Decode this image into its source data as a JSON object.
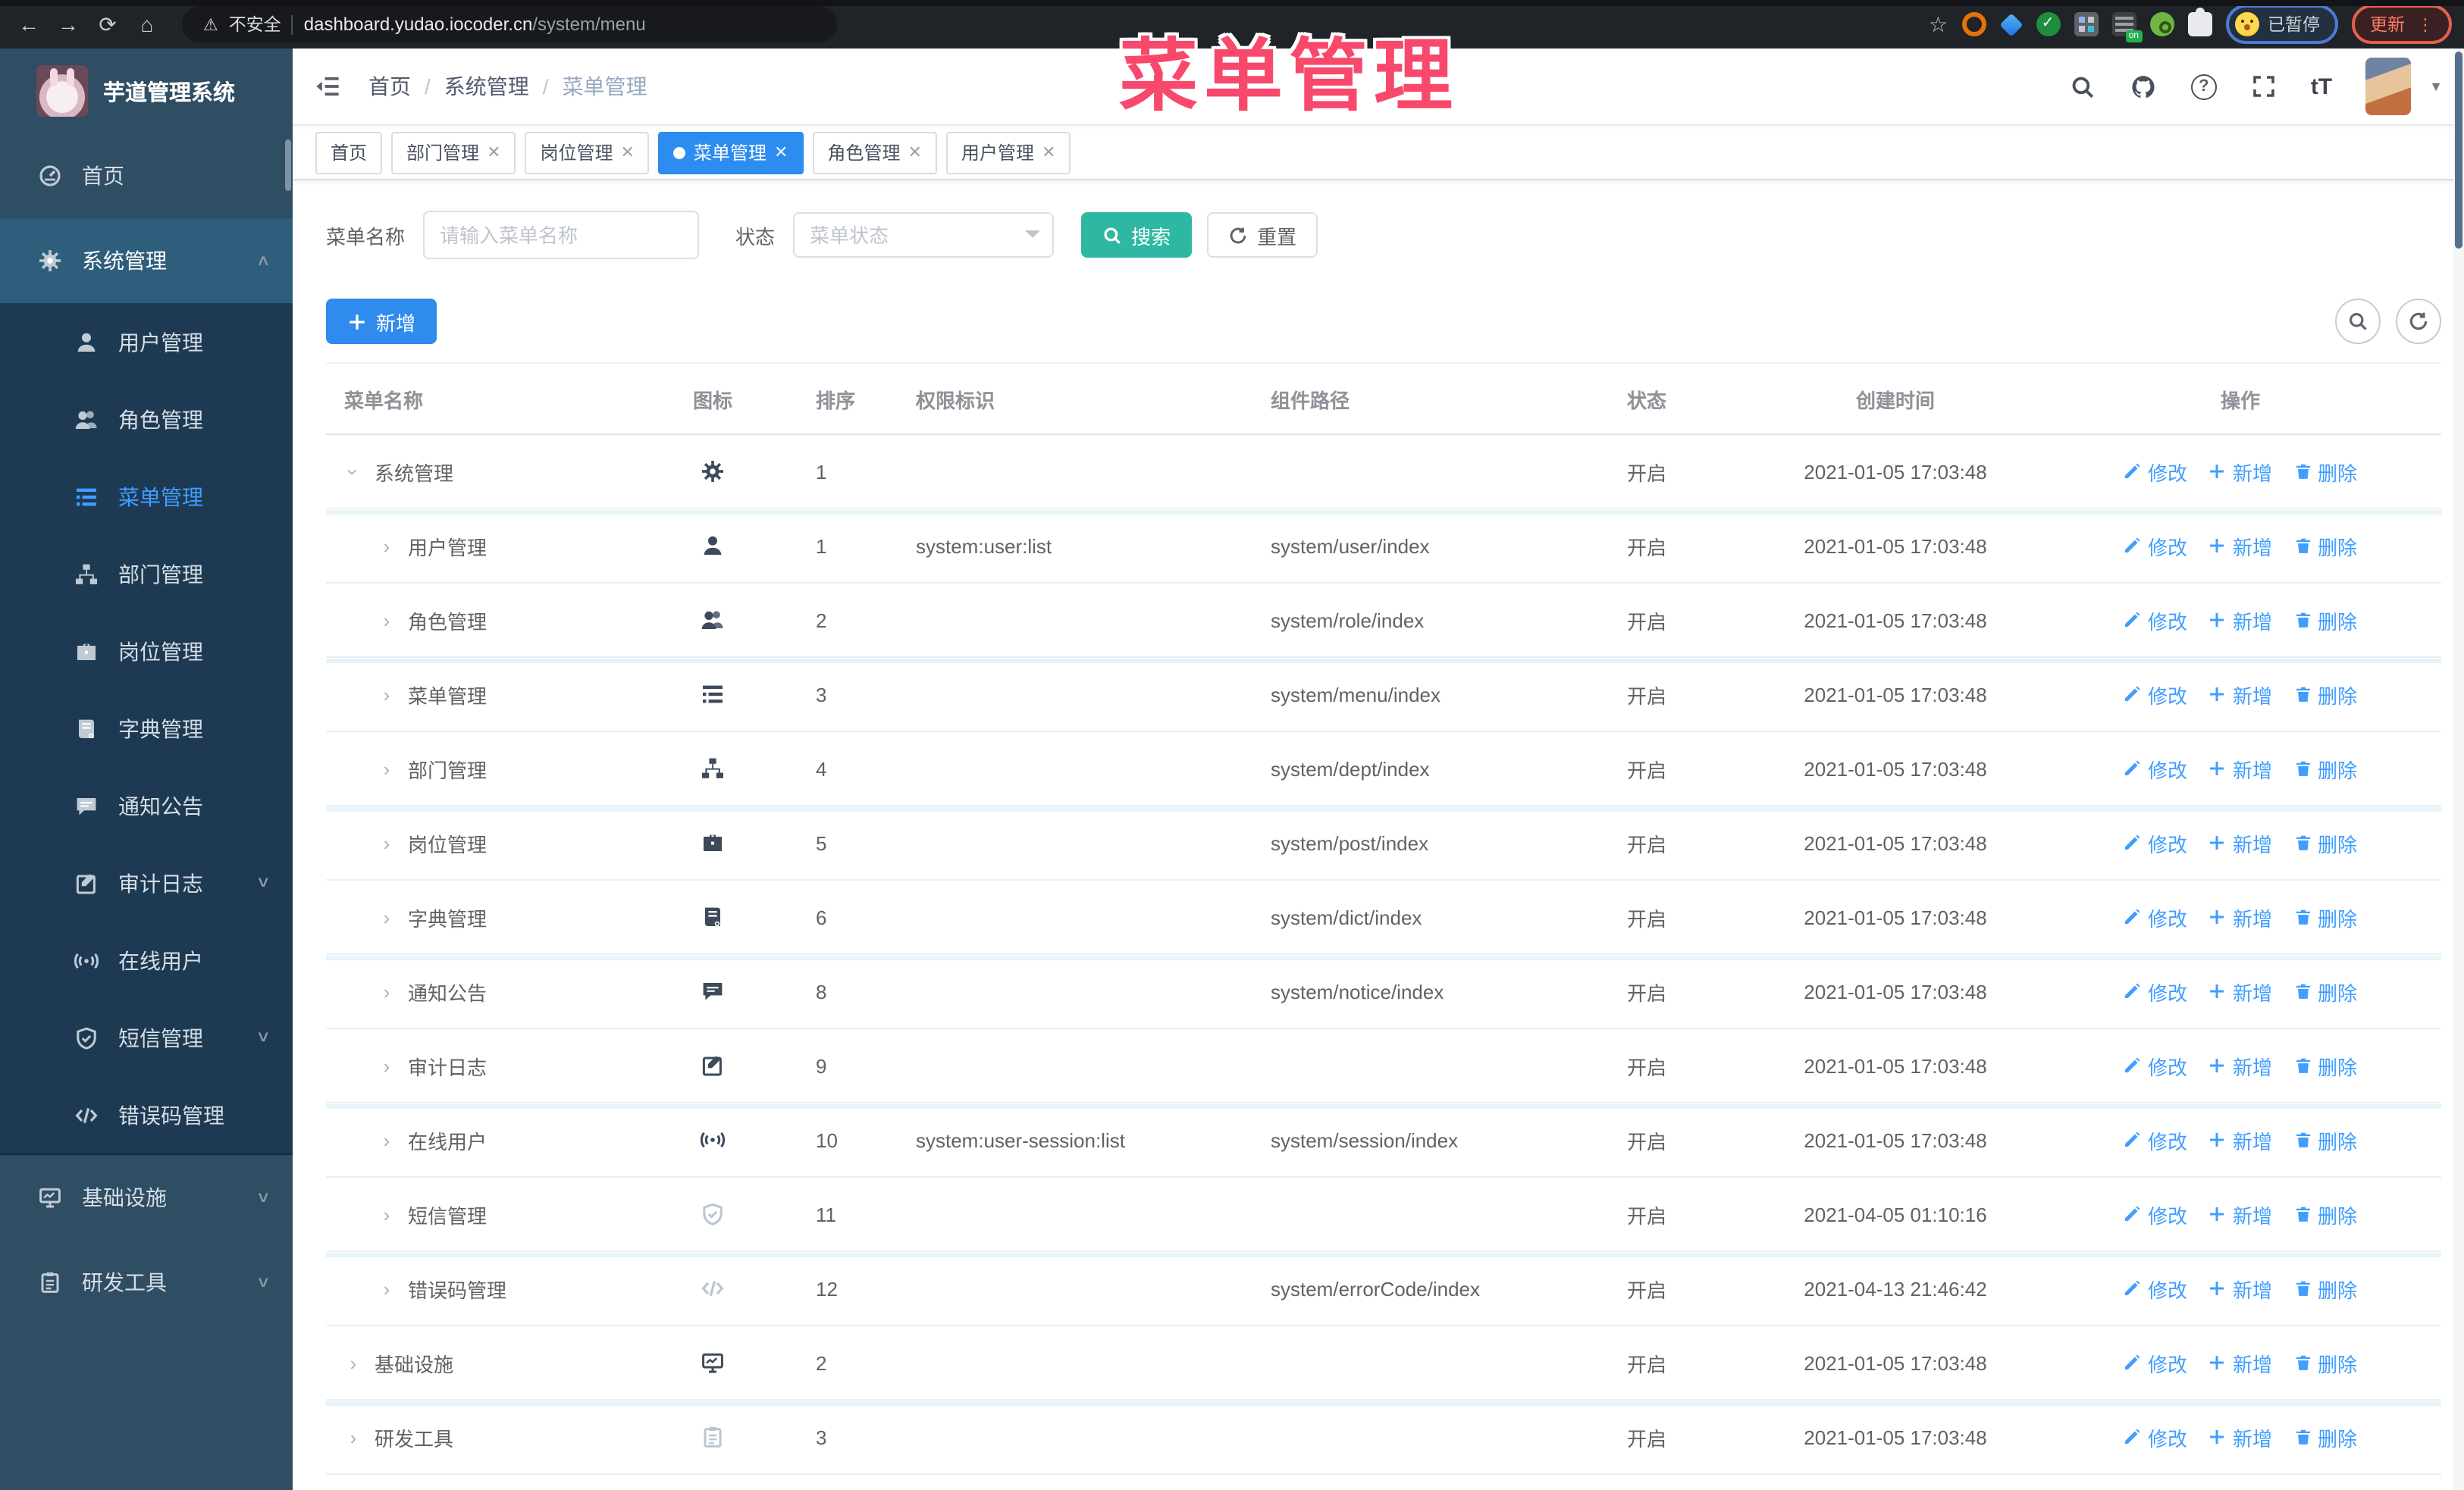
{
  "browser": {
    "security_label": "不安全",
    "url_host": "dashboard.yudao.iocoder.cn",
    "url_path": "/system/menu",
    "paused_badge": "已暂停",
    "update_button": "更新"
  },
  "overlay": {
    "title": "菜单管理"
  },
  "sidebar": {
    "logo_title": "芋道管理系统",
    "items": [
      {
        "label": "首页",
        "icon": "dashboard",
        "type": "root"
      },
      {
        "label": "系统管理",
        "icon": "gear",
        "type": "parent-open",
        "chevron": "up"
      },
      {
        "label": "用户管理",
        "icon": "user",
        "type": "sub"
      },
      {
        "label": "角色管理",
        "icon": "users",
        "type": "sub"
      },
      {
        "label": "菜单管理",
        "icon": "tree-table",
        "type": "sub",
        "active": true
      },
      {
        "label": "部门管理",
        "icon": "tree",
        "type": "sub"
      },
      {
        "label": "岗位管理",
        "icon": "post",
        "type": "sub"
      },
      {
        "label": "字典管理",
        "icon": "dict",
        "type": "sub"
      },
      {
        "label": "通知公告",
        "icon": "message",
        "type": "sub"
      },
      {
        "label": "审计日志",
        "icon": "log",
        "type": "sub",
        "chevron": "down"
      },
      {
        "label": "在线用户",
        "icon": "online",
        "type": "sub"
      },
      {
        "label": "短信管理",
        "icon": "sms",
        "type": "sub",
        "chevron": "down"
      },
      {
        "label": "错误码管理",
        "icon": "code",
        "type": "sub"
      },
      {
        "label": "基础设施",
        "icon": "monitor",
        "type": "root",
        "chevron": "down"
      },
      {
        "label": "研发工具",
        "icon": "tool",
        "type": "root",
        "chevron": "down"
      }
    ]
  },
  "header": {
    "breadcrumb": [
      "首页",
      "系统管理",
      "菜单管理"
    ]
  },
  "tabs": [
    {
      "label": "首页",
      "closable": false,
      "active": false
    },
    {
      "label": "部门管理",
      "closable": true,
      "active": false
    },
    {
      "label": "岗位管理",
      "closable": true,
      "active": false
    },
    {
      "label": "菜单管理",
      "closable": true,
      "active": true
    },
    {
      "label": "角色管理",
      "closable": true,
      "active": false
    },
    {
      "label": "用户管理",
      "closable": true,
      "active": false
    }
  ],
  "search": {
    "name_label": "菜单名称",
    "name_placeholder": "请输入菜单名称",
    "status_label": "状态",
    "status_placeholder": "菜单状态",
    "search_button": "搜索",
    "reset_button": "重置"
  },
  "toolbar": {
    "add_button": "新增"
  },
  "table": {
    "headers": [
      "菜单名称",
      "图标",
      "排序",
      "权限标识",
      "组件路径",
      "状态",
      "创建时间",
      "操作"
    ],
    "actions": [
      "修改",
      "新增",
      "删除"
    ],
    "rows": [
      {
        "name": "系统管理",
        "icon": "gear",
        "level": 0,
        "expanded": true,
        "sort": "1",
        "perm": "",
        "path": "",
        "status": "开启",
        "time": "2021-01-05 17:03:48"
      },
      {
        "name": "用户管理",
        "icon": "user",
        "level": 1,
        "expanded": false,
        "sort": "1",
        "perm": "system:user:list",
        "path": "system/user/index",
        "status": "开启",
        "time": "2021-01-05 17:03:48"
      },
      {
        "name": "角色管理",
        "icon": "users",
        "level": 1,
        "expanded": false,
        "sort": "2",
        "perm": "",
        "path": "system/role/index",
        "status": "开启",
        "time": "2021-01-05 17:03:48"
      },
      {
        "name": "菜单管理",
        "icon": "tree-table",
        "level": 1,
        "expanded": false,
        "sort": "3",
        "perm": "",
        "path": "system/menu/index",
        "status": "开启",
        "time": "2021-01-05 17:03:48"
      },
      {
        "name": "部门管理",
        "icon": "tree",
        "level": 1,
        "expanded": false,
        "sort": "4",
        "perm": "",
        "path": "system/dept/index",
        "status": "开启",
        "time": "2021-01-05 17:03:48"
      },
      {
        "name": "岗位管理",
        "icon": "post",
        "level": 1,
        "expanded": false,
        "sort": "5",
        "perm": "",
        "path": "system/post/index",
        "status": "开启",
        "time": "2021-01-05 17:03:48"
      },
      {
        "name": "字典管理",
        "icon": "dict",
        "level": 1,
        "expanded": false,
        "sort": "6",
        "perm": "",
        "path": "system/dict/index",
        "status": "开启",
        "time": "2021-01-05 17:03:48"
      },
      {
        "name": "通知公告",
        "icon": "message",
        "level": 1,
        "expanded": false,
        "sort": "8",
        "perm": "",
        "path": "system/notice/index",
        "status": "开启",
        "time": "2021-01-05 17:03:48"
      },
      {
        "name": "审计日志",
        "icon": "log",
        "level": 1,
        "expanded": false,
        "sort": "9",
        "perm": "",
        "path": "",
        "status": "开启",
        "time": "2021-01-05 17:03:48"
      },
      {
        "name": "在线用户",
        "icon": "online",
        "level": 1,
        "expanded": false,
        "sort": "10",
        "perm": "system:user-session:list",
        "path": "system/session/index",
        "status": "开启",
        "time": "2021-01-05 17:03:48"
      },
      {
        "name": "短信管理",
        "icon": "sms",
        "level": 1,
        "expanded": false,
        "sort": "11",
        "perm": "",
        "path": "",
        "status": "开启",
        "time": "2021-04-05 01:10:16",
        "muted": true
      },
      {
        "name": "错误码管理",
        "icon": "code",
        "level": 1,
        "expanded": false,
        "sort": "12",
        "perm": "",
        "path": "system/errorCode/index",
        "status": "开启",
        "time": "2021-04-13 21:46:42",
        "muted": true
      },
      {
        "name": "基础设施",
        "icon": "monitor",
        "level": 0,
        "expanded": false,
        "sort": "2",
        "perm": "",
        "path": "",
        "status": "开启",
        "time": "2021-01-05 17:03:48"
      },
      {
        "name": "研发工具",
        "icon": "tool",
        "level": 0,
        "expanded": false,
        "sort": "3",
        "perm": "",
        "path": "",
        "status": "开启",
        "time": "2021-01-05 17:03:48",
        "muted": true
      }
    ]
  },
  "colors": {
    "accent_blue": "#2f8bed",
    "teal": "#2eb8a2",
    "link_blue": "#409eff",
    "sidebar_bg": "#2f4d63",
    "submenu_bg": "#1e3a52",
    "overlay_pink": "#f8486b",
    "status_open": "开启"
  }
}
